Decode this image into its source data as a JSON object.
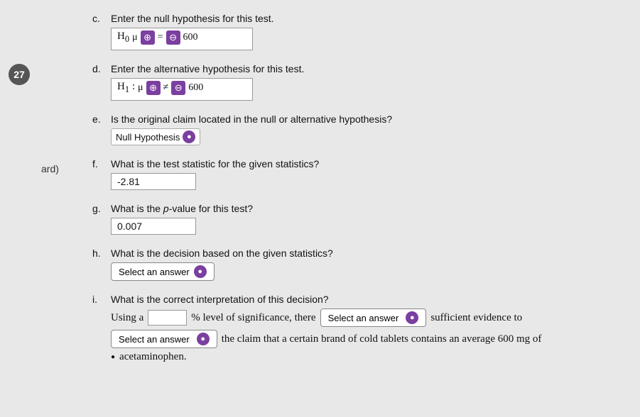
{
  "question_number": "27",
  "side_label": "ard)",
  "parts": {
    "c": {
      "label": "c.",
      "instruction": "Enter the null hypothesis for this test.",
      "h_label": "H",
      "h_sub": "0",
      "mu": "μ",
      "eq_sign": "=",
      "value": "600"
    },
    "d": {
      "label": "d.",
      "instruction": "Enter the alternative hypothesis for this test.",
      "h_label": "H",
      "h_sub": "1",
      "mu": "μ",
      "neq_sign": "≠",
      "value": "600"
    },
    "e": {
      "label": "e.",
      "instruction": "Is the original claim located in the null or alternative hypothesis?",
      "select_value": "Null Hypothesis"
    },
    "f": {
      "label": "f.",
      "instruction": "What is the test statistic for the given statistics?",
      "value": "-2.81"
    },
    "g": {
      "label": "g.",
      "instruction_part1": "What is the ",
      "instruction_italic": "p",
      "instruction_part2": "-value for this test?",
      "value": "0.007"
    },
    "h": {
      "label": "h.",
      "instruction": "What is the decision based on the given statistics?",
      "select_label": "Select an answer"
    },
    "i": {
      "label": "i.",
      "instruction": "What is the correct interpretation of this decision?",
      "line1_prefix": "Using a",
      "line1_suffix": "% level of significance, there",
      "line1_select": "Select an answer",
      "line1_end": "sufficient evidence to",
      "line2_select": "Select an answer",
      "line2_end": "the claim that a certain brand of cold tablets contains an average 600 mg of",
      "line3": "acetaminophen."
    }
  }
}
